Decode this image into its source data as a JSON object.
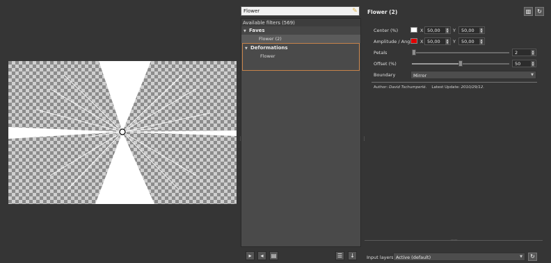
{
  "search": {
    "value": "Flower"
  },
  "filter_list": {
    "header": "Available filters (569)",
    "folders": [
      {
        "label": "Faves",
        "items": [
          "Flower (2)"
        ]
      },
      {
        "label": "Deformations",
        "items": [
          "Flower"
        ]
      }
    ]
  },
  "params": {
    "title": "Flower (2)",
    "center": {
      "label": "Center (%)",
      "color": "#ffffff",
      "x_label": "X",
      "x": "50,00",
      "y_label": "Y",
      "y": "50,00"
    },
    "amplitude": {
      "label": "Amplitude / Angle",
      "color": "#e00000",
      "x_label": "X",
      "x": "50,00",
      "y_label": "Y",
      "y": "50,00"
    },
    "petals": {
      "label": "Petals",
      "value": "2",
      "fraction": 0.0
    },
    "offset": {
      "label": "Offset (%)",
      "value": "50",
      "fraction": 0.5
    },
    "boundary": {
      "label": "Boundary",
      "value": "Mirror"
    },
    "author": {
      "prefix": "Author:",
      "name": "David Tschumperlé.",
      "update_prefix": "Latest Update:",
      "date": "2010/29/12."
    }
  },
  "input_layers": {
    "label": "Input layers",
    "value": "Active (default)"
  },
  "icons": {
    "clear_search": "broom-icon",
    "add_fave": "add-fave-icon",
    "remove_fave": "remove-fave-icon",
    "rename_fave": "rename-fave-icon",
    "list_view": "list-view-icon",
    "update": "download-icon",
    "visibility": "preview-toggle-icon",
    "reset": "reset-icon",
    "refresh": "refresh-icon"
  },
  "colors": {
    "accent_border": "#c7834a",
    "panel": "#4a4a4a",
    "background": "#353535"
  }
}
